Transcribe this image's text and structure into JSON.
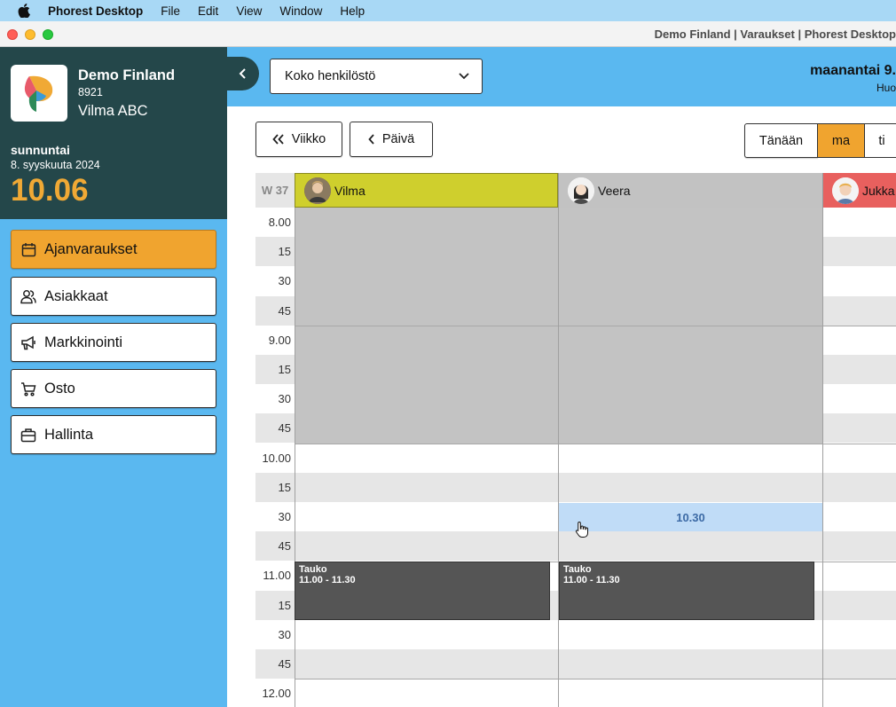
{
  "menubar": {
    "app_name": "Phorest Desktop",
    "items": [
      "File",
      "Edit",
      "View",
      "Window",
      "Help"
    ]
  },
  "window": {
    "title": "Demo Finland | Varaukset | Phorest Desktop"
  },
  "sidebar": {
    "org_name": "Demo Finland",
    "org_id": "8921",
    "user_name": "Vilma ABC",
    "day_name": "sunnuntai",
    "date": "8. syyskuuta 2024",
    "time": "10.06",
    "nav": [
      {
        "label": "Ajanvaraukset",
        "icon": "calendar-icon",
        "active": true
      },
      {
        "label": "Asiakkaat",
        "icon": "users-icon",
        "active": false
      },
      {
        "label": "Markkinointi",
        "icon": "megaphone-icon",
        "active": false
      },
      {
        "label": "Osto",
        "icon": "cart-icon",
        "active": false
      },
      {
        "label": "Hallinta",
        "icon": "briefcase-icon",
        "active": false
      }
    ]
  },
  "header": {
    "staff_filter": "Koko henkilöstö",
    "date_title": "maanantai 9.",
    "date_sub": "Huo"
  },
  "toolbar": {
    "week_label": "Viikko",
    "day_label": "Päivä",
    "today_label": "Tänään",
    "days": [
      {
        "label": "ma",
        "active": true
      },
      {
        "label": "ti",
        "active": false
      }
    ]
  },
  "calendar": {
    "week": "W 37",
    "staff": [
      {
        "name": "Vilma",
        "color": "#cfcf2d"
      },
      {
        "name": "Veera",
        "color": "#c2c2c2"
      },
      {
        "name": "Jukka",
        "color": "#e8605e"
      }
    ],
    "times": [
      "8.00",
      "15",
      "30",
      "45",
      "9.00",
      "15",
      "30",
      "45",
      "10.00",
      "15",
      "30",
      "45",
      "11.00",
      "15",
      "30",
      "45",
      "12.00"
    ],
    "hover_slot": "10.30",
    "breaks": [
      {
        "title": "Tauko",
        "time": "11.00 - 11.30"
      },
      {
        "title": "Tauko",
        "time": "11.00 - 11.30"
      }
    ]
  }
}
